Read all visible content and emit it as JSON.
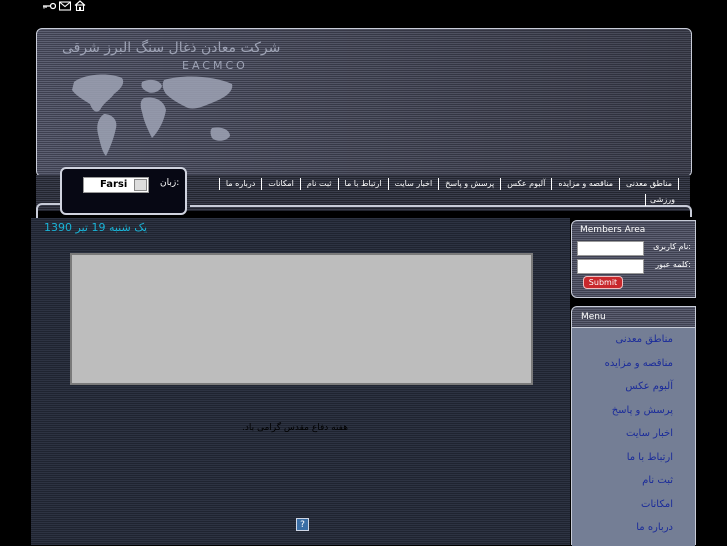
{
  "top_icons": [
    "key-icon",
    "mail-icon",
    "home-icon"
  ],
  "header": {
    "company_name": "شرکت معادن ذغال سنگ البرز شرقی",
    "company_abbr": "EACMCO"
  },
  "nav": {
    "items": [
      "مناطق معدنی",
      "مناقصه و مزایده",
      "آلبوم عکس",
      "پرسش و پاسخ",
      "اخبار سایت",
      "ارتباط با ما",
      "ثبت نام",
      "امکانات",
      "درباره ما"
    ],
    "second_row": "ورزشی"
  },
  "language": {
    "label": "زبان:",
    "selected": "Farsi"
  },
  "main": {
    "date": "یک شنبه 19 تیر 1390",
    "message": "هفته دفاع مقدس گرامی باد.",
    "help_icon": "?"
  },
  "members": {
    "title": "Members Area",
    "username_label": "نام کاربری:",
    "password_label": "کلمه عبور:",
    "username_value": "",
    "password_value": "",
    "submit_label": "Submit"
  },
  "menu": {
    "title": "Menu",
    "items": [
      "مناطق معدنی",
      "مناقصه و مزایده",
      "آلبوم عکس",
      "پرسش و پاسخ",
      "اخبار سایت",
      "ارتباط با ما",
      "ثبت نام",
      "امکانات",
      "درباره ما"
    ]
  },
  "colors": {
    "accent_link": "#1a2b9a",
    "date_color": "#19b3d6",
    "submit_bg": "#c8282c"
  }
}
